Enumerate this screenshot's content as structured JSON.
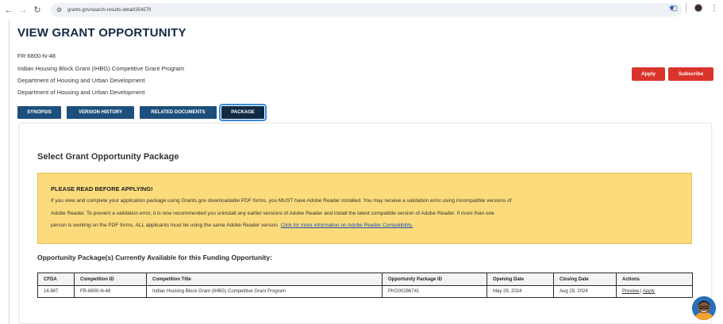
{
  "browser": {
    "url": "grants.gov/search-results-detail/354579",
    "icons": {
      "back": "back-arrow-icon",
      "forward": "forward-arrow-icon",
      "reload": "reload-icon",
      "site_settings": "tune-icon",
      "bookmark": "star-icon",
      "extensions": "extension-icon",
      "profile": "profile-avatar",
      "menu": "more-vert-icon"
    }
  },
  "page": {
    "title": "VIEW GRANT OPPORTUNITY",
    "opportunity_number": "FR-6800-N-48",
    "opportunity_title": "Indian Housing Block Grant (IHBG) Competitive Grant Program",
    "agency": "Department of Housing and Urban Development",
    "agency2": "Department of Housing and Urban Development"
  },
  "actions": {
    "apply": "Apply",
    "subscribe": "Subscribe"
  },
  "tabs": [
    "SYNOPSIS",
    "VERSION HISTORY",
    "RELATED DOCUMENTS",
    "PACKAGE"
  ],
  "active_tab": "PACKAGE",
  "package": {
    "heading": "Select Grant Opportunity Package",
    "notice": {
      "title": "PLEASE READ BEFORE APPLYING!",
      "line1": "If you view and complete your application package using Grants.gov downloadable PDF forms, you MUST have Adobe Reader installed. You may receive a validation error using incompatible versions of",
      "line2": "Adobe Reader. To prevent a validation error, it is now recommended you uninstall any earlier versions of Adobe Reader and install the latest compatible version of Adobe Reader. If more than one",
      "line3": "person is working on the PDF forms, ALL applicants must be using the same Adobe Reader version.",
      "link": "Click for more information on Adobe Reader Compatibility."
    },
    "available_heading": "Opportunity Package(s) Currently Available for this Funding Opportunity:",
    "table": {
      "headers": [
        "CFDA",
        "Competition ID",
        "Competition Title",
        "Opportunity Package ID",
        "Opening Date",
        "Closing Date",
        "Actions"
      ],
      "rows": [
        {
          "cfda": "14.867",
          "competition_id": "FR-6800-N-48",
          "competition_title": "Indian Housing Block Grant (IHBG) Competitive Grant Program",
          "package_id": "PKG00286741",
          "opening_date": "May 29, 2024",
          "closing_date": "Aug 29, 2024",
          "action_preview": "Preview",
          "action_sep": "|",
          "action_apply": "Apply"
        }
      ]
    }
  },
  "colors": {
    "primary_dark": "#1d4f7c",
    "apply_red": "#d9342b",
    "notice_bg": "#fbdb7b"
  }
}
